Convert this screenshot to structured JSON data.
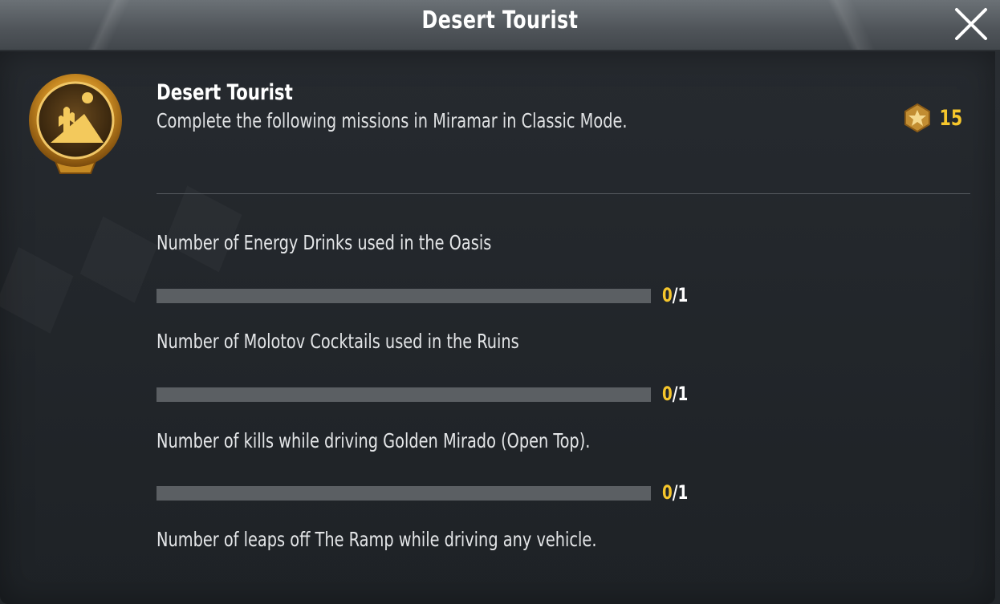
{
  "window": {
    "title": "Desert Tourist"
  },
  "achievement": {
    "name": "Desert Tourist",
    "description": "Complete the following missions in Miramar in Classic Mode.",
    "reward_points": "15"
  },
  "missions": [
    {
      "label": "Number of Energy Drinks used in the Oasis",
      "current": "0",
      "total": "1",
      "progress": 0
    },
    {
      "label": "Number of Molotov Cocktails used in the Ruins",
      "current": "0",
      "total": "1",
      "progress": 0
    },
    {
      "label": "Number of kills while driving Golden Mirado (Open Top).",
      "current": "0",
      "total": "1",
      "progress": 0
    },
    {
      "label": "Number of leaps off The Ramp while driving any vehicle."
    }
  ],
  "colors": {
    "accent": "#f6c62c",
    "track": "#5b5f63",
    "text": "#e3e5e7"
  },
  "icons": {
    "close": "close-x-icon",
    "badge": "desert-cactus-badge-icon",
    "reward": "star-medal-icon"
  }
}
